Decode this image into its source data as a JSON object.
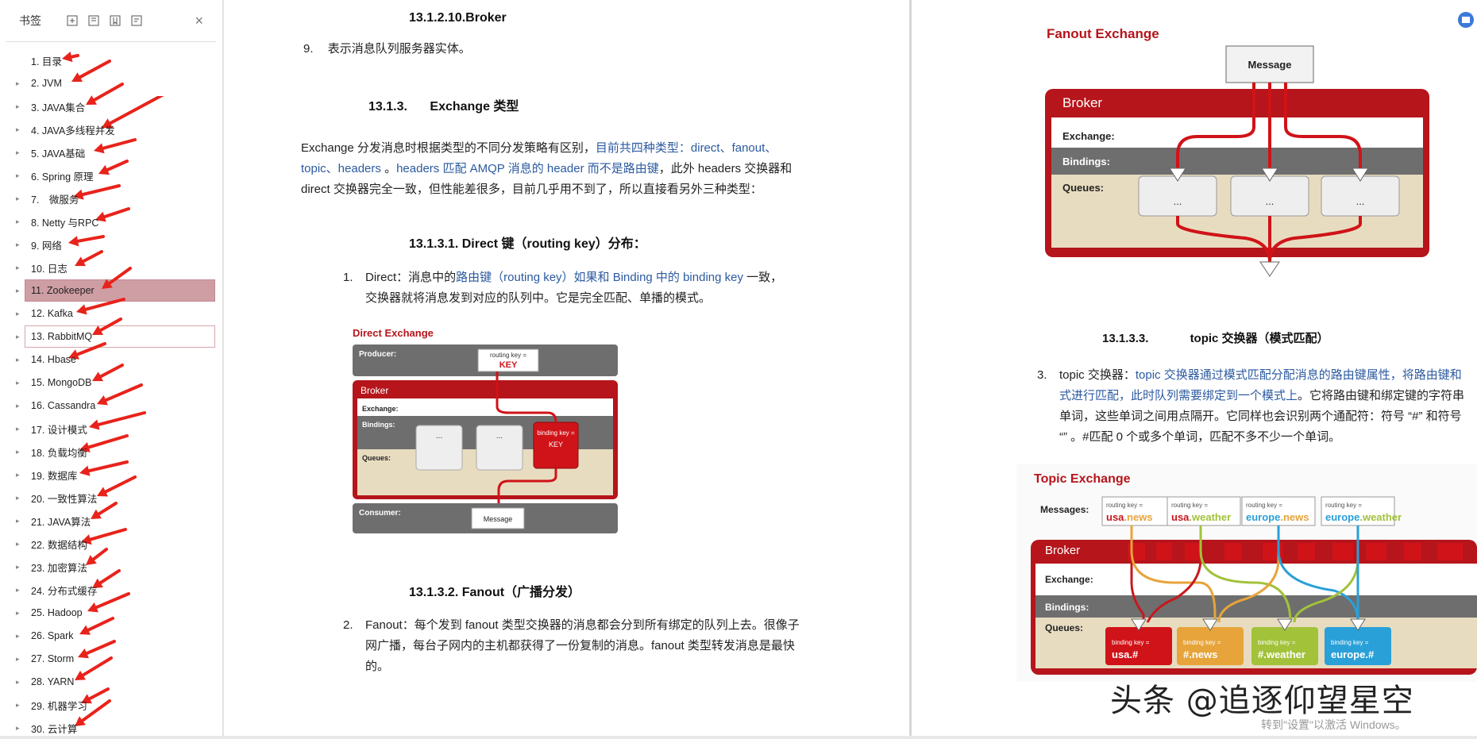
{
  "sidebar": {
    "title": "书签",
    "bookmarks": [
      {
        "label": "1. 目录"
      },
      {
        "label": "2. JVM"
      },
      {
        "label": "3. JAVA集合"
      },
      {
        "label": "4. JAVA多线程并发"
      },
      {
        "label": "5. JAVA基础"
      },
      {
        "label": "6. Spring 原理"
      },
      {
        "label": "7.　微服务"
      },
      {
        "label": "8. Netty 与RPC"
      },
      {
        "label": "9. 网络"
      },
      {
        "label": "10. 日志"
      },
      {
        "label": "11. Zookeeper"
      },
      {
        "label": "12. Kafka"
      },
      {
        "label": "13. RabbitMQ"
      },
      {
        "label": "14. Hbase"
      },
      {
        "label": "15. MongoDB"
      },
      {
        "label": "16. Cassandra"
      },
      {
        "label": "17. 设计模式"
      },
      {
        "label": "18. 负载均衡"
      },
      {
        "label": "19. 数据库"
      },
      {
        "label": "20. 一致性算法"
      },
      {
        "label": "21. JAVA算法"
      },
      {
        "label": "22. 数据结构"
      },
      {
        "label": "23. 加密算法"
      },
      {
        "label": "24. 分布式缓存"
      },
      {
        "label": "25. Hadoop"
      },
      {
        "label": "26. Spark"
      },
      {
        "label": "27. Storm"
      },
      {
        "label": "28. YARN"
      },
      {
        "label": "29. 机器学习"
      },
      {
        "label": "30. 云计算"
      }
    ]
  },
  "page1": {
    "broker_heading": "13.1.2.10.Broker",
    "broker_item_num": "9.",
    "broker_item_text": "表示消息队列服务器实体。",
    "exchange_heading_num": "13.1.3.",
    "exchange_heading_text": "Exchange 类型",
    "exchange_p_a": "Exchange 分发消息时根据类型的不同分发策略有区别，",
    "exchange_p_link1": "目前共四种类型：direct、fanout、",
    "exchange_p_link2": "topic、headers",
    "exchange_p_b": " 。",
    "exchange_p_link3": "headers 匹配 AMQP 消息的 header 而不是路由键",
    "exchange_p_c": "，此外 headers 交换器和",
    "exchange_p_d": "direct 交换器完全一致，但性能差很多，目前几乎用不到了，所以直接看另外三种类型：",
    "direct_heading": "13.1.3.1.  Direct 键（routing key）分布：",
    "direct_num": "1.",
    "direct_a": "Direct：消息中的",
    "direct_link": "路由键（routing key）如果和 Binding 中的 binding key",
    "direct_b": " 一致，",
    "direct_c": "交换器就将消息发到对应的队列中。它是完全匹配、单播的模式。",
    "fanout_heading": "13.1.3.2.  Fanout（广播分发）",
    "fanout_num": "2.",
    "fanout_a": "Fanout：每个发到 fanout 类型交换器的消息都会分到所有绑定的队列上去。很像子",
    "fanout_b": "网广播，每台子网内的主机都获得了一份复制的消息。fanout 类型转发消息是最快",
    "fanout_c": "的。"
  },
  "direct_diagram": {
    "title": "Direct Exchange",
    "producer": "Producer:",
    "routing_key_label": "routing key =",
    "routing_key_value": "KEY",
    "broker": "Broker",
    "exchange": "Exchange:",
    "bindings": "Bindings:",
    "queues": "Queues:",
    "dots": "...",
    "binding_key_label": "binding key =",
    "binding_key_value": "KEY",
    "consumer": "Consumer:",
    "message": "Message"
  },
  "page2": {
    "fanout_title": "Fanout Exchange",
    "message": "Message",
    "broker": "Broker",
    "exchange": "Exchange:",
    "bindings": "Bindings:",
    "queues": "Queues:",
    "dots": "...",
    "topic_heading_num": "13.1.3.3.",
    "topic_heading_text": "topic 交换器（模式匹配）",
    "topic_num": "3.",
    "topic_a": "topic 交换器：",
    "topic_link1": "topic 交换器通过模式匹配分配消息的路由键属性，将路由键和",
    "topic_link2": "式进行匹配，此时队列需要绑定到一个模式上",
    "topic_b": "。它将路由键和绑定键的字符串",
    "topic_c": "单词，这些单词之间用点隔开。它同样也会识别两个通配符：符号 “#” 和符号",
    "topic_d": "“” 。#匹配 0 个或多个单词，匹配不多不少一个单词。",
    "topic_title": "Topic Exchange",
    "messages_label": "Messages:",
    "rk_label": "routing key =",
    "rk": [
      {
        "a": "usa",
        "b": ".news"
      },
      {
        "a": "usa",
        "b": ".weather"
      },
      {
        "a": "europe",
        "b": ".news"
      },
      {
        "a": "europe",
        "b": ".weather"
      }
    ],
    "bk_label": "binding key =",
    "bk": [
      "usa.#",
      "#.news",
      "#.weather",
      "europe.#"
    ],
    "colors": {
      "red": "#c8171d",
      "accent": "#2c5aa0"
    }
  },
  "watermark": {
    "main": "头条 @追逐仰望星空",
    "sub": "转到\"设置\"以激活 Windows。"
  }
}
